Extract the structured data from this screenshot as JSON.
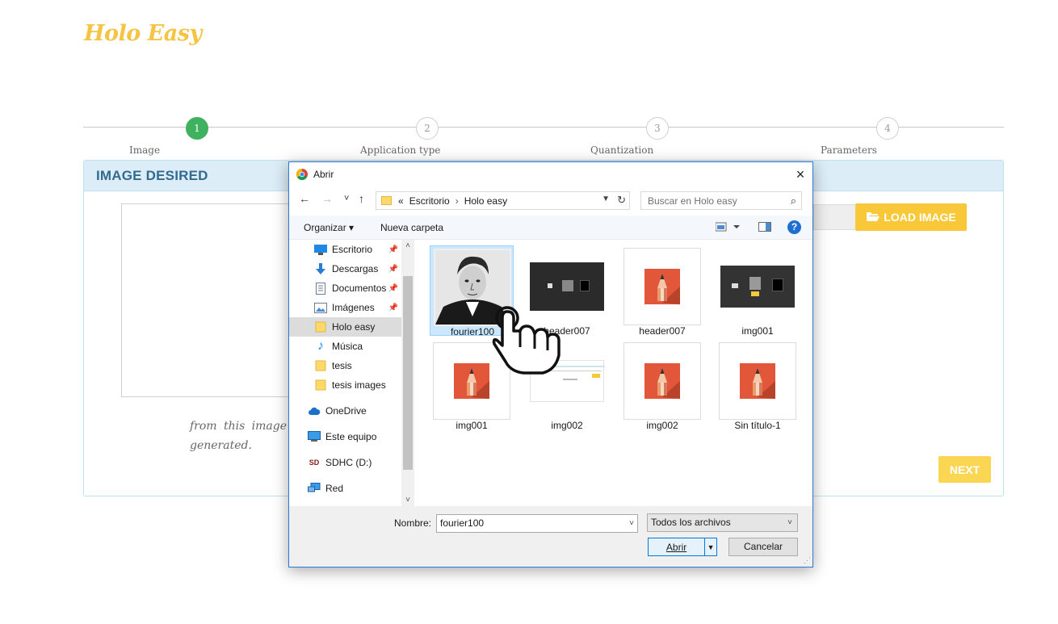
{
  "app": {
    "logo": "Holo Easy"
  },
  "stepper": {
    "steps": [
      {
        "num": "1",
        "label": "Image",
        "active": true
      },
      {
        "num": "2",
        "label": "Application type",
        "active": false
      },
      {
        "num": "3",
        "label": "Quantization",
        "active": false
      },
      {
        "num": "4",
        "label": "Parameters",
        "active": false
      }
    ]
  },
  "panel": {
    "title": "IMAGE DESIRED",
    "load_button": "LOAD IMAGE",
    "description": "from this image generated.",
    "next_button": "NEXT"
  },
  "dialog": {
    "title": "Abrir",
    "close": "×",
    "nav": {
      "back": "←",
      "forward": "→",
      "recent": "˅",
      "up": "↑"
    },
    "address": {
      "prefix": "«",
      "part1": "Escritorio",
      "sep": "›",
      "part2": "Holo easy"
    },
    "search_placeholder": "Buscar en Holo easy",
    "toolbar": {
      "organize": "Organizar ▾",
      "new_folder": "Nueva carpeta",
      "help": "?"
    },
    "nav_pane": [
      {
        "label": "Escritorio",
        "icon": "desktop-icon",
        "pinned": true
      },
      {
        "label": "Descargas",
        "icon": "download-icon",
        "pinned": true
      },
      {
        "label": "Documentos",
        "icon": "document-icon",
        "pinned": true
      },
      {
        "label": "Imágenes",
        "icon": "pictures-icon",
        "pinned": true
      },
      {
        "label": "Holo easy",
        "icon": "folder-icon",
        "selected": true
      },
      {
        "label": "Música",
        "icon": "music-icon"
      },
      {
        "label": "tesis",
        "icon": "folder-icon"
      },
      {
        "label": "tesis images",
        "icon": "folder-icon"
      },
      {
        "label": "OneDrive",
        "icon": "cloud-icon"
      },
      {
        "label": "Este equipo",
        "icon": "computer-icon"
      },
      {
        "label": "SDHC (D:)",
        "icon": "sd-card-icon"
      },
      {
        "label": "Red",
        "icon": "network-icon"
      }
    ],
    "sd_badge": "SD",
    "files": [
      {
        "name": "fourier100",
        "kind": "portrait",
        "selected": true
      },
      {
        "name": "header007",
        "kind": "dark-screenshot"
      },
      {
        "name": "header007",
        "kind": "pencil"
      },
      {
        "name": "img001",
        "kind": "dark-screenshot-2"
      },
      {
        "name": "img001",
        "kind": "pencil"
      },
      {
        "name": "img002",
        "kind": "light-screenshot"
      },
      {
        "name": "img002",
        "kind": "pencil"
      },
      {
        "name": "Sin título-1",
        "kind": "pencil"
      }
    ],
    "filename_label": "Nombre:",
    "filename_value": "fourier100",
    "filter_value": "Todos los archivos",
    "open_button": "Abrir",
    "cancel_button": "Cancelar"
  },
  "colors": {
    "logo": "#f6c445",
    "step_active": "#3fb15f",
    "panel_header_bg": "#dcedf7",
    "panel_title": "#336a8f",
    "load_button": "#f8c838",
    "next_button": "#fad653",
    "dialog_border": "#2d7ad6",
    "selection": "#cce8ff"
  }
}
